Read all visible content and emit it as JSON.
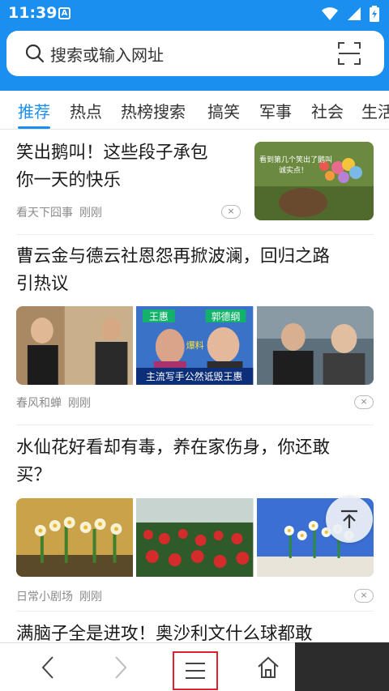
{
  "status_bar": {
    "time": "11:39",
    "notification_glyph": "A",
    "icons": [
      "wifi-icon",
      "signal-icon",
      "battery-charging-icon"
    ]
  },
  "search": {
    "placeholder": "搜索或输入网址",
    "icon": "search-icon",
    "right_icon": "scan-icon"
  },
  "tabs": [
    "推荐",
    "热点",
    "热榜搜索",
    "搞笑",
    "军事",
    "社会",
    "生活"
  ],
  "active_tab": "推荐",
  "articles": [
    {
      "title_lines": [
        "笑出鹅叫！这些段子承包",
        "你一天的快乐"
      ],
      "source": "看天下囧事",
      "time": "刚刚",
      "thumb_text": [
        "看到第几个笑出了鹅叫",
        "诚实点！"
      ]
    },
    {
      "title_lines": [
        "曹云金与德云社恩怨再掀波澜，回归之路",
        "引热议"
      ],
      "source": "春风和蝉",
      "time": "刚刚",
      "img_text": {
        "name1": "王惠",
        "name2": "郭德纲",
        "tag": "爆料",
        "caption": "主流写手公然诋毁王惠"
      }
    },
    {
      "title_lines": [
        "水仙花好看却有毒，养在家伤身，你还敢",
        "买？"
      ],
      "source": "日常小剧场",
      "time": "刚刚"
    },
    {
      "title_lines": [
        "满脑子全是进攻！奥沙利文什么球都敢"
      ]
    }
  ],
  "buttons": {
    "dismiss": "×",
    "back": "back-icon",
    "forward": "forward-icon",
    "menu": "menu-icon",
    "home": "home-icon",
    "to_top": "arrow-up-icon"
  },
  "colors": {
    "brand_blue": "#1a8ff0",
    "highlight_red": "#e0202a"
  }
}
